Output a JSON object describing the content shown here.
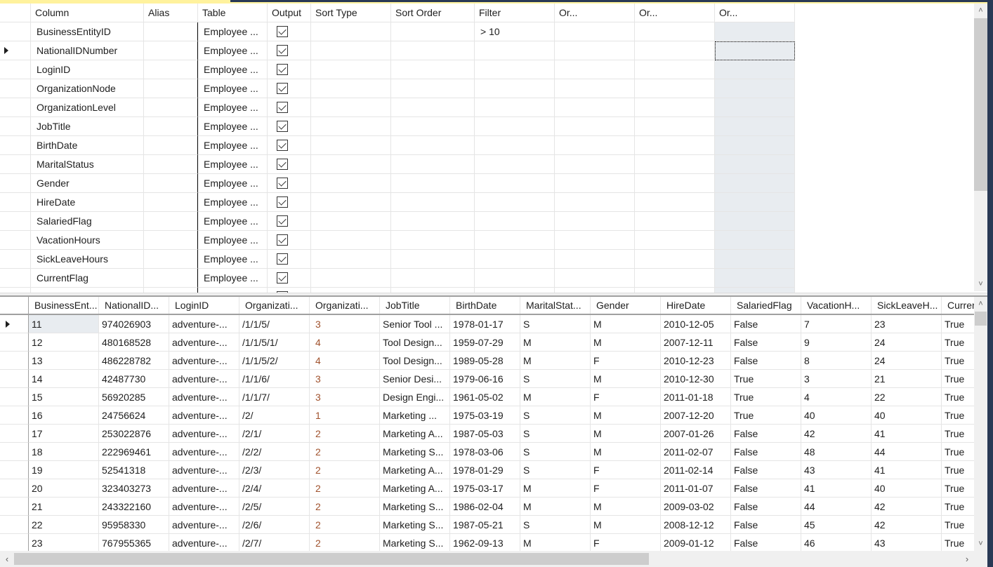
{
  "criteria_pane": {
    "headers": [
      "",
      "Column",
      "Alias",
      "Table",
      "Output",
      "Sort Type",
      "Sort Order",
      "Filter",
      "Or...",
      "Or...",
      "Or..."
    ],
    "rows": [
      {
        "column": "BusinessEntityID",
        "alias": "",
        "table": "Employee ...",
        "output": true,
        "sort_type": "",
        "sort_order": "",
        "filter": "> 10",
        "or1": "",
        "or2": "",
        "or3": ""
      },
      {
        "column": "NationalIDNumber",
        "alias": "",
        "table": "Employee ...",
        "output": true,
        "sort_type": "",
        "sort_order": "",
        "filter": "",
        "or1": "",
        "or2": "",
        "or3": "",
        "current": true
      },
      {
        "column": "LoginID",
        "alias": "",
        "table": "Employee ...",
        "output": true,
        "sort_type": "",
        "sort_order": "",
        "filter": "",
        "or1": "",
        "or2": "",
        "or3": ""
      },
      {
        "column": "OrganizationNode",
        "alias": "",
        "table": "Employee ...",
        "output": true,
        "sort_type": "",
        "sort_order": "",
        "filter": "",
        "or1": "",
        "or2": "",
        "or3": ""
      },
      {
        "column": "OrganizationLevel",
        "alias": "",
        "table": "Employee ...",
        "output": true,
        "sort_type": "",
        "sort_order": "",
        "filter": "",
        "or1": "",
        "or2": "",
        "or3": ""
      },
      {
        "column": "JobTitle",
        "alias": "",
        "table": "Employee ...",
        "output": true,
        "sort_type": "",
        "sort_order": "",
        "filter": "",
        "or1": "",
        "or2": "",
        "or3": ""
      },
      {
        "column": "BirthDate",
        "alias": "",
        "table": "Employee ...",
        "output": true,
        "sort_type": "",
        "sort_order": "",
        "filter": "",
        "or1": "",
        "or2": "",
        "or3": ""
      },
      {
        "column": "MaritalStatus",
        "alias": "",
        "table": "Employee ...",
        "output": true,
        "sort_type": "",
        "sort_order": "",
        "filter": "",
        "or1": "",
        "or2": "",
        "or3": ""
      },
      {
        "column": "Gender",
        "alias": "",
        "table": "Employee ...",
        "output": true,
        "sort_type": "",
        "sort_order": "",
        "filter": "",
        "or1": "",
        "or2": "",
        "or3": ""
      },
      {
        "column": "HireDate",
        "alias": "",
        "table": "Employee ...",
        "output": true,
        "sort_type": "",
        "sort_order": "",
        "filter": "",
        "or1": "",
        "or2": "",
        "or3": ""
      },
      {
        "column": "SalariedFlag",
        "alias": "",
        "table": "Employee ...",
        "output": true,
        "sort_type": "",
        "sort_order": "",
        "filter": "",
        "or1": "",
        "or2": "",
        "or3": ""
      },
      {
        "column": "VacationHours",
        "alias": "",
        "table": "Employee ...",
        "output": true,
        "sort_type": "",
        "sort_order": "",
        "filter": "",
        "or1": "",
        "or2": "",
        "or3": ""
      },
      {
        "column": "SickLeaveHours",
        "alias": "",
        "table": "Employee ...",
        "output": true,
        "sort_type": "",
        "sort_order": "",
        "filter": "",
        "or1": "",
        "or2": "",
        "or3": ""
      },
      {
        "column": "CurrentFlag",
        "alias": "",
        "table": "Employee ...",
        "output": true,
        "sort_type": "",
        "sort_order": "",
        "filter": "",
        "or1": "",
        "or2": "",
        "or3": ""
      },
      {
        "column": "",
        "alias": "",
        "table": "",
        "output": true,
        "sort_type": "",
        "sort_order": "",
        "filter": "",
        "or1": "",
        "or2": "",
        "or3": ""
      }
    ]
  },
  "results_pane": {
    "headers": [
      "",
      "BusinessEnt...",
      "NationalID...",
      "LoginID",
      "Organizati...",
      "Organizati...",
      "JobTitle",
      "BirthDate",
      "MaritalStat...",
      "Gender",
      "HireDate",
      "SalariedFlag",
      "VacationH...",
      "SickLeaveH...",
      "Currer"
    ],
    "rows": [
      [
        "11",
        "974026903",
        "adventure-...",
        "/1/1/5/",
        "3",
        "Senior Tool ...",
        "1978-01-17",
        "S",
        "M",
        "2010-12-05",
        "False",
        "7",
        "23",
        "True"
      ],
      [
        "12",
        "480168528",
        "adventure-...",
        "/1/1/5/1/",
        "4",
        "Tool Design...",
        "1959-07-29",
        "M",
        "M",
        "2007-12-11",
        "False",
        "9",
        "24",
        "True"
      ],
      [
        "13",
        "486228782",
        "adventure-...",
        "/1/1/5/2/",
        "4",
        "Tool Design...",
        "1989-05-28",
        "M",
        "F",
        "2010-12-23",
        "False",
        "8",
        "24",
        "True"
      ],
      [
        "14",
        "42487730",
        "adventure-...",
        "/1/1/6/",
        "3",
        "Senior Desi...",
        "1979-06-16",
        "S",
        "M",
        "2010-12-30",
        "True",
        "3",
        "21",
        "True"
      ],
      [
        "15",
        "56920285",
        "adventure-...",
        "/1/1/7/",
        "3",
        "Design Engi...",
        "1961-05-02",
        "M",
        "F",
        "2011-01-18",
        "True",
        "4",
        "22",
        "True"
      ],
      [
        "16",
        "24756624",
        "adventure-...",
        "/2/",
        "1",
        "Marketing ...",
        "1975-03-19",
        "S",
        "M",
        "2007-12-20",
        "True",
        "40",
        "40",
        "True"
      ],
      [
        "17",
        "253022876",
        "adventure-...",
        "/2/1/",
        "2",
        "Marketing A...",
        "1987-05-03",
        "S",
        "M",
        "2007-01-26",
        "False",
        "42",
        "41",
        "True"
      ],
      [
        "18",
        "222969461",
        "adventure-...",
        "/2/2/",
        "2",
        "Marketing S...",
        "1978-03-06",
        "S",
        "M",
        "2011-02-07",
        "False",
        "48",
        "44",
        "True"
      ],
      [
        "19",
        "52541318",
        "adventure-...",
        "/2/3/",
        "2",
        "Marketing A...",
        "1978-01-29",
        "S",
        "F",
        "2011-02-14",
        "False",
        "43",
        "41",
        "True"
      ],
      [
        "20",
        "323403273",
        "adventure-...",
        "/2/4/",
        "2",
        "Marketing A...",
        "1975-03-17",
        "M",
        "F",
        "2011-01-07",
        "False",
        "41",
        "40",
        "True"
      ],
      [
        "21",
        "243322160",
        "adventure-...",
        "/2/5/",
        "2",
        "Marketing S...",
        "1986-02-04",
        "M",
        "M",
        "2009-03-02",
        "False",
        "44",
        "42",
        "True"
      ],
      [
        "22",
        "95958330",
        "adventure-...",
        "/2/6/",
        "2",
        "Marketing S...",
        "1987-05-21",
        "S",
        "M",
        "2008-12-12",
        "False",
        "45",
        "42",
        "True"
      ],
      [
        "23",
        "767955365",
        "adventure-...",
        "/2/7/",
        "2",
        "Marketing S...",
        "1962-09-13",
        "M",
        "F",
        "2009-01-12",
        "False",
        "46",
        "43",
        "True"
      ]
    ]
  },
  "icons": {
    "scroll_up": "▲",
    "scroll_down": "▼",
    "scroll_left": "‹",
    "scroll_right": "›",
    "row_selector": "row-pointer-triangle"
  },
  "colors": {
    "accent_dark": "#293955",
    "accent_yellow": "#fff29d",
    "level_text": "#a0522d",
    "selected_cell": "#e8ecf0"
  }
}
